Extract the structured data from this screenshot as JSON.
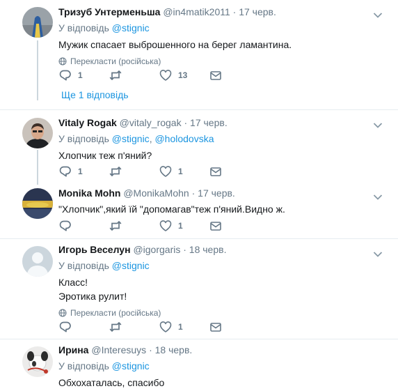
{
  "tweets": [
    {
      "name": "Тризуб Унтерменьша",
      "handle": "@in4matik2011",
      "sep": "·",
      "date": "17 черв.",
      "reply_prefix": "У відповідь",
      "reply_to": [
        "@stignic"
      ],
      "text": "Мужик спасает выброшенного на берег ламантина.",
      "translate": "Перекласти (російська)",
      "replies": "1",
      "retweets": "",
      "likes": "13"
    },
    {
      "name": "Vitaly Rogak",
      "handle": "@vitaly_rogak",
      "sep": "·",
      "date": "17 черв.",
      "reply_prefix": "У відповідь",
      "reply_to": [
        "@stignic",
        "@holodovska"
      ],
      "reply_joiner": ", ",
      "text": "Хлопчик теж п'яний?",
      "replies": "1",
      "retweets": "",
      "likes": "1"
    },
    {
      "name": "Monika Mohn",
      "handle": "@MonikaMohn",
      "sep": "·",
      "date": "17 черв.",
      "text": "\"Хлопчик\",який їй \"допомагав\"теж п'яний.Видно ж.",
      "replies": "",
      "retweets": "",
      "likes": "1"
    },
    {
      "name": "Игорь Веселун",
      "handle": "@igorgaris",
      "sep": "·",
      "date": "18 черв.",
      "reply_prefix": "У відповідь",
      "reply_to": [
        "@stignic"
      ],
      "text_lines": [
        "Класс!",
        "Эротика рулит!"
      ],
      "translate": "Перекласти (російська)",
      "replies": "",
      "retweets": "",
      "likes": "1"
    },
    {
      "name": "Ирина",
      "handle": "@Interesuys",
      "sep": "·",
      "date": "18 черв.",
      "reply_prefix": "У відповідь",
      "reply_to": [
        "@stignic"
      ],
      "text": "Обхохаталась, спасибо"
    }
  ],
  "more_replies": "Ще 1 відповідь",
  "colors": {
    "link": "#1b95e0",
    "muted": "#657786",
    "text": "#14171a",
    "divider": "#e6ecf0",
    "thread": "#ccd6dd"
  }
}
